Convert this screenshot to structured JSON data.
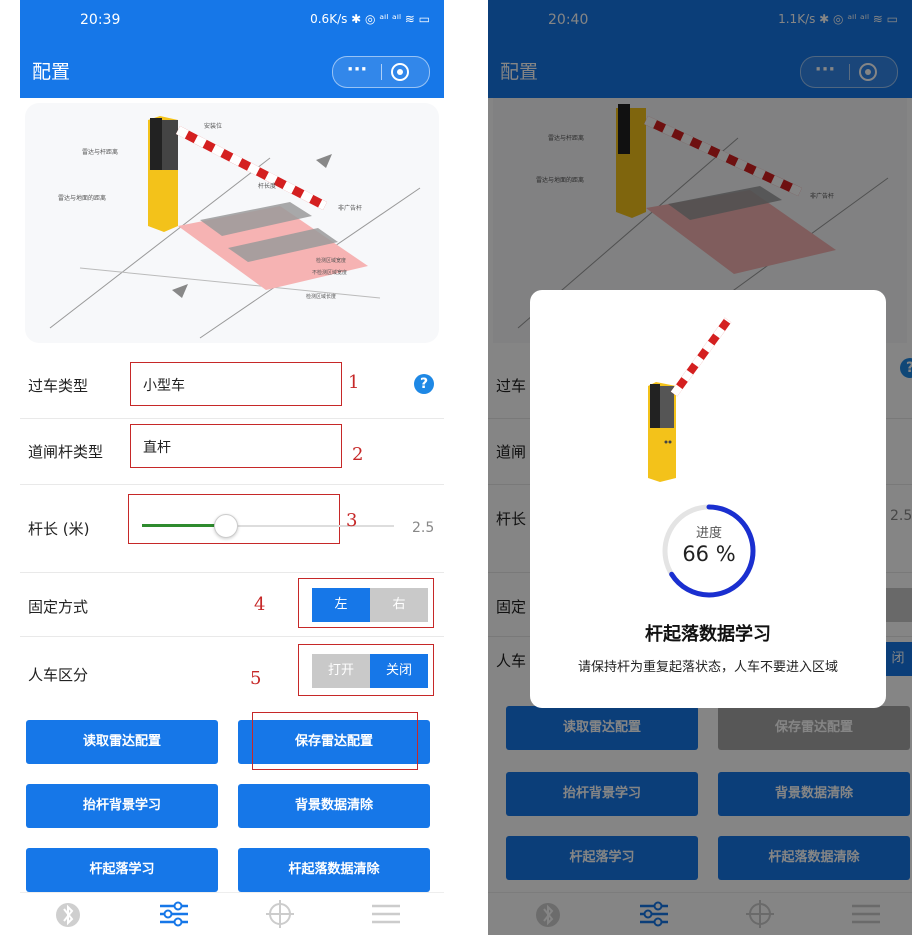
{
  "left_phone": {
    "status": {
      "time": "20:39",
      "right": "0.6K/s ✱ ◎ ᵃᴵˡ ᵃᴵˡ ≋ ▭"
    },
    "header": {
      "title": "配置",
      "more_label": "···"
    },
    "form": {
      "vehicle_type": {
        "label": "过车类型",
        "value": "小型车",
        "annotation": "1"
      },
      "barrier_type": {
        "label": "道闸杆类型",
        "value": "直杆",
        "annotation": "2"
      },
      "pole_length": {
        "label": "杆长 (米)",
        "value": "2.5",
        "annotation": "3",
        "slider_fraction": 0.33
      },
      "mount": {
        "label": "固定方式",
        "annotation": "4",
        "options": [
          "左",
          "右"
        ],
        "selected": "左"
      },
      "ped_vehicle": {
        "label": "人车区分",
        "annotation": "5",
        "options": [
          "打开",
          "关闭"
        ],
        "selected": "关闭"
      }
    },
    "buttons": {
      "read_radar": "读取雷达配置",
      "save_radar": "保存雷达配置",
      "lift_bg_learn": "抬杆背景学习",
      "clear_bg": "背景数据清除",
      "pole_learn": "杆起落学习",
      "clear_pole": "杆起落数据清除"
    }
  },
  "right_phone": {
    "status": {
      "time": "20:40",
      "right": "1.1K/s ✱ ◎ ᵃᴵˡ ᵃᴵˡ ≋ ▭"
    },
    "header": {
      "title": "配置",
      "more_label": "···"
    },
    "partial": {
      "row1": "过车",
      "row2": "道闸",
      "row3": "杆长",
      "row4": "固定",
      "row5": "人车",
      "value_edge": "2.5",
      "toggle_edge": "闭",
      "help": "?"
    },
    "buttons": {
      "read_radar": "读取雷达配置",
      "save_radar": "保存雷达配置",
      "lift_bg_learn": "抬杆背景学习",
      "clear_bg": "背景数据清除",
      "pole_learn": "杆起落学习",
      "clear_pole": "杆起落数据清除"
    },
    "modal": {
      "progress_label": "进度",
      "progress_text": "66 %",
      "progress_fraction": 0.66,
      "title": "杆起落数据学习",
      "message": "请保持杆为重复起落状态，人车不要进入区域"
    }
  },
  "colors": {
    "primary": "#1677e8",
    "annotation_red": "#c62828",
    "slider_green": "#2e8b2e",
    "toggle_gray": "#c9c9c9"
  },
  "icons": [
    "bluetooth-icon",
    "sliders-icon",
    "crosshair-icon",
    "menu-icon"
  ]
}
